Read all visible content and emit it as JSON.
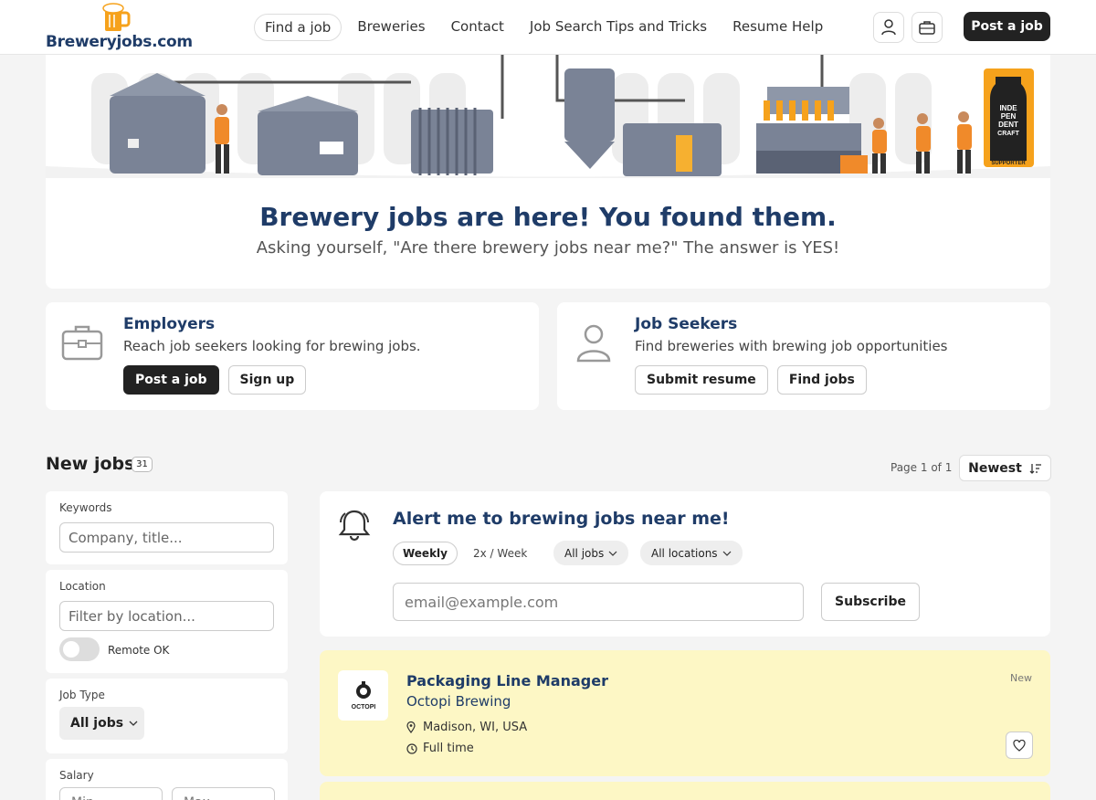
{
  "nav": {
    "logo_text": "Breweryjobs.com",
    "links": [
      "Find a job",
      "Breweries",
      "Contact",
      "Job Search Tips and Tricks",
      "Resume Help"
    ],
    "post_job": "Post a job"
  },
  "hero": {
    "title": "Brewery jobs are here! You found them.",
    "subtitle": "Asking yourself, \"Are there brewery jobs near me?\" The answer is YES!",
    "badge_lines": [
      "INDE",
      "PEN",
      "DENT",
      "CRAFT"
    ],
    "badge_supporter": "SUPPORTER"
  },
  "employers": {
    "title": "Employers",
    "desc": "Reach job seekers looking for brewing jobs.",
    "btn_post": "Post a job",
    "btn_signup": "Sign up"
  },
  "seekers": {
    "title": "Job Seekers",
    "desc": "Find breweries with brewing job opportunities",
    "btn_resume": "Submit resume",
    "btn_find": "Find jobs"
  },
  "jobs_header": {
    "title": "New jobs",
    "count": "31",
    "page_info": "Page 1 of 1",
    "sort": "Newest"
  },
  "filters": {
    "keywords_label": "Keywords",
    "keywords_placeholder": "Company, title...",
    "location_label": "Location",
    "location_placeholder": "Filter by location...",
    "remote_label": "Remote OK",
    "jobtype_label": "Job Type",
    "jobtype_value": "All jobs",
    "salary_label": "Salary",
    "salary_min": "Min",
    "salary_max": "Max"
  },
  "alert": {
    "title": "Alert me to brewing jobs near me!",
    "freq_weekly": "Weekly",
    "freq_2x": "2x / Week",
    "jobs_pill": "All jobs",
    "locations_pill": "All locations",
    "email_placeholder": "email@example.com",
    "subscribe": "Subscribe"
  },
  "job": {
    "title": "Packaging Line Manager",
    "company": "Octopi Brewing",
    "location": "Madison, WI, USA",
    "type": "Full time",
    "badge": "New",
    "logo_text": "OCTOPI"
  },
  "colors": {
    "navy": "#1f3c68",
    "job_highlight": "#fdf7c5",
    "dark_button": "#222222"
  }
}
